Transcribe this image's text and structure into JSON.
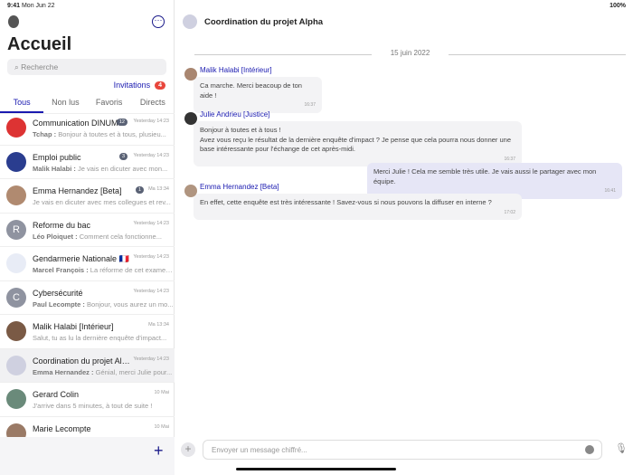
{
  "status": {
    "time": "9:41",
    "date": "Mon Jun 22",
    "battery": "100%"
  },
  "sidebar": {
    "title": "Accueil",
    "search_placeholder": "Recherche",
    "invitations": "Invitations",
    "invitations_count": "4",
    "tabs": [
      "Tous",
      "Non lus",
      "Favoris",
      "Directs"
    ],
    "rooms": [
      {
        "name": "Communication DINUM",
        "time": "Yesterday 14:23",
        "badge": "12",
        "sender": "Tchap :",
        "preview": "Bonjour à toutes et à tous, plusieu...",
        "avatar": "",
        "color": "#d33"
      },
      {
        "name": "Emploi public",
        "time": "Yesterday 14:23",
        "badge": "3",
        "sender": "Malik Halabi :",
        "preview": "Je vais en dicuter avec mon...",
        "avatar": "",
        "color": "#2a3d8f"
      },
      {
        "name": "Emma Hernandez [Beta]",
        "time": "Ma 13:34",
        "badge": "1",
        "sender": "",
        "preview": "Je vais en dicuter avec mes collegues et rev...",
        "avatar": "",
        "color": "#b08a70"
      },
      {
        "name": "Reforme du bac",
        "time": "Yesterday 14:23",
        "badge": "",
        "sender": "Léo Ploiquet :",
        "preview": "Comment cela fonctionne...",
        "avatar": "R",
        "color": "#8f93a0"
      },
      {
        "name": "Gendarmerie Nationale 🇫🇷",
        "time": "Yesterday 14:23",
        "badge": "",
        "sender": "Marcel François :",
        "preview": "La réforme de cet examen...",
        "avatar": "",
        "color": "#e8ecf6"
      },
      {
        "name": "Cybersécurité",
        "time": "Yesterday 14:23",
        "badge": "",
        "sender": "Paul Lecompte :",
        "preview": "Bonjour, vous aurez un mo...",
        "avatar": "C",
        "color": "#8f93a0"
      },
      {
        "name": "Malik Halabi [Intérieur]",
        "time": "Ma 13:34",
        "badge": "",
        "sender": "",
        "preview": "Salut, tu as lu la dernière enquête d'impact...",
        "avatar": "",
        "color": "#7a5a45"
      },
      {
        "name": "Coordination du projet Alp...",
        "time": "Yesterday 14:23",
        "badge": "",
        "sender": "Emma Hernandez :",
        "preview": "Génial, merci Julie pour...",
        "avatar": "",
        "color": "#cfd0e0"
      },
      {
        "name": "Gerard Colin",
        "time": "10 Mai",
        "badge": "",
        "sender": "",
        "preview": "J'arrive dans 5 minutes, à tout de suite !",
        "avatar": "",
        "color": "#6a8a7a"
      },
      {
        "name": "Marie Lecompte",
        "time": "10 Mai",
        "badge": "",
        "sender": "",
        "preview": "",
        "avatar": "",
        "color": "#9a7a66"
      }
    ]
  },
  "chat": {
    "title": "Coordination du projet Alpha",
    "date": "15 juin 2022",
    "messages": [
      {
        "sender": "Malik Halabi [Intérieur]",
        "text": "Ca marche. Merci beacoup de ton aide !",
        "time": "16:37"
      },
      {
        "sender": "Julie Andrieu [Justice]",
        "text": "Bonjour à toutes et à tous !\nAvez vous reçu le résultat de la dernière enquête d'impact ? Je pense que cela pourra nous donner une base intéressante pour l'échange de cet après-midi.",
        "time": "16:37"
      },
      {
        "sender": "",
        "text": "Merci Julie ! Cela me semble très utile. Je vais aussi le partager avec mon équipe.",
        "time": "16:41"
      },
      {
        "sender": "Emma Hernandez [Beta]",
        "text": "En effet, cette enquête est très intéressante ! Savez-vous si nous pouvons la diffuser en interne ?",
        "time": "17:02"
      }
    ],
    "composer_placeholder": "Envoyer un message chiffré..."
  }
}
